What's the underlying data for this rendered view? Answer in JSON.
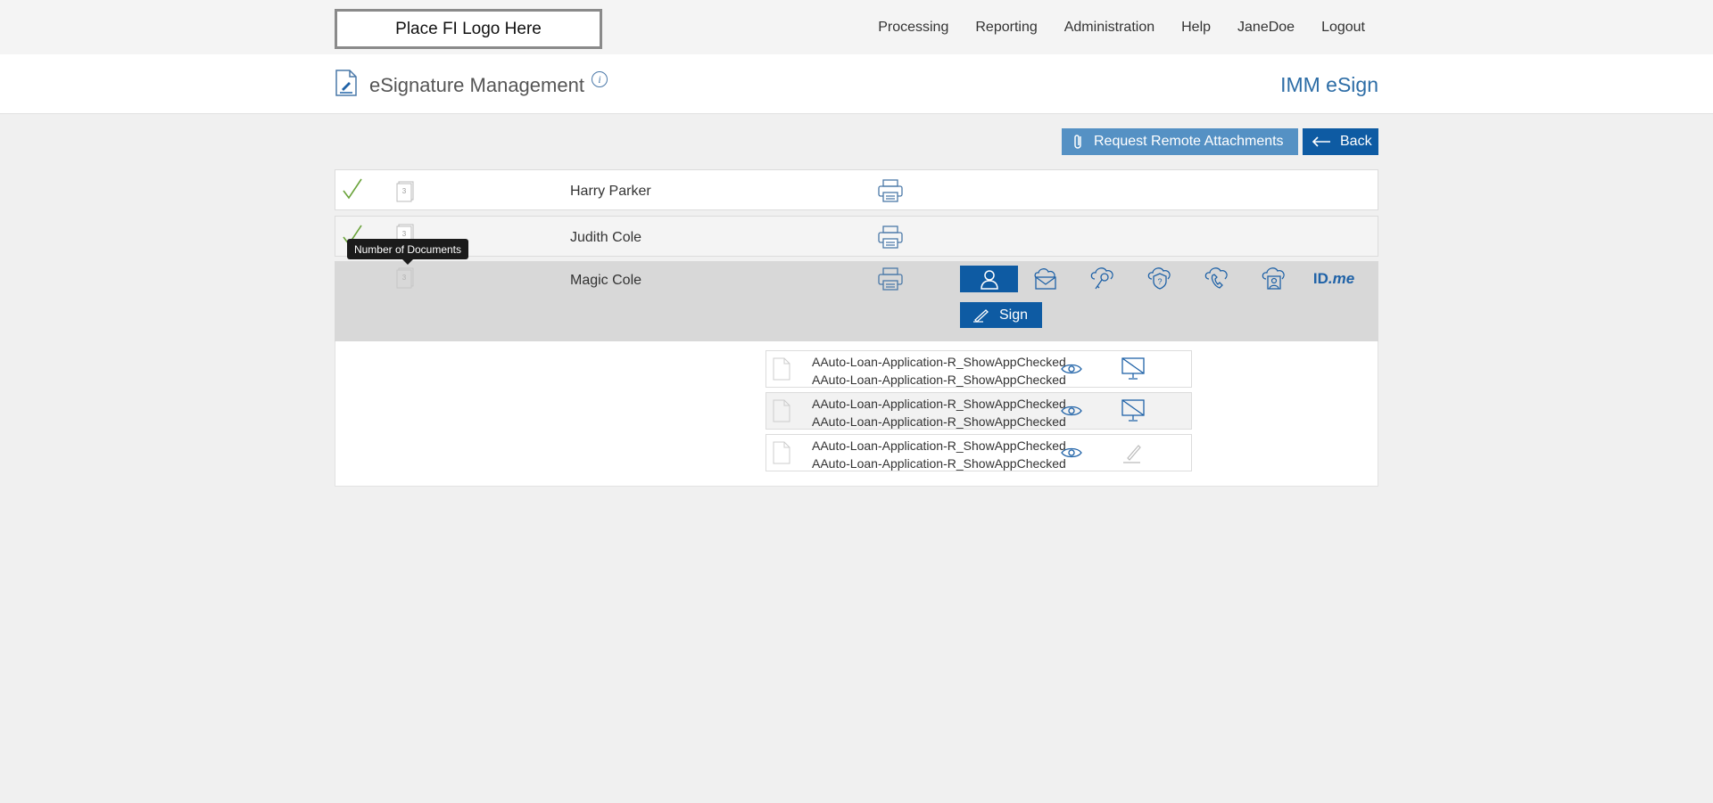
{
  "topbar": {
    "logo_text": "Place FI Logo Here",
    "nav": [
      "Processing",
      "Reporting",
      "Administration",
      "Help",
      "JaneDoe",
      "Logout"
    ]
  },
  "header": {
    "title": "eSignature Management",
    "info_icon": "i",
    "brand": "IMM eSign"
  },
  "actions": {
    "request_attachments": "Request Remote Attachments",
    "back": "Back"
  },
  "signers": [
    {
      "name": "Harry Parker",
      "completed": true,
      "doc_count": "3"
    },
    {
      "name": "Judith Cole",
      "completed": true,
      "doc_count": "3"
    },
    {
      "name": "Magic Cole",
      "completed": false,
      "doc_count": "3"
    }
  ],
  "tooltip": "Number of Documents",
  "auth_methods": [
    "user-icon",
    "email-cloud-icon",
    "key-cloud-icon",
    "question-cloud-icon",
    "phone-cloud-icon",
    "person-cloud-icon",
    "idme-logo"
  ],
  "idme": {
    "id": "ID",
    "me": ".me"
  },
  "sign_button": "Sign",
  "documents": [
    {
      "line1": "AAuto-Loan-Application-R_ShowAppChecked",
      "line2": "AAuto-Loan-Application-R_ShowAppChecked",
      "action": "no-display-icon"
    },
    {
      "line1": "AAuto-Loan-Application-R_ShowAppChecked",
      "line2": "AAuto-Loan-Application-R_ShowAppChecked",
      "action": "no-display-icon"
    },
    {
      "line1": "AAuto-Loan-Application-R_ShowAppChecked",
      "line2": "AAuto-Loan-Application-R_ShowAppChecked",
      "action": "pen-icon"
    }
  ],
  "colors": {
    "primary": "#0e5ba3",
    "secondary": "#5591c4",
    "check": "#6aa33a",
    "brand": "#2d6da6"
  }
}
